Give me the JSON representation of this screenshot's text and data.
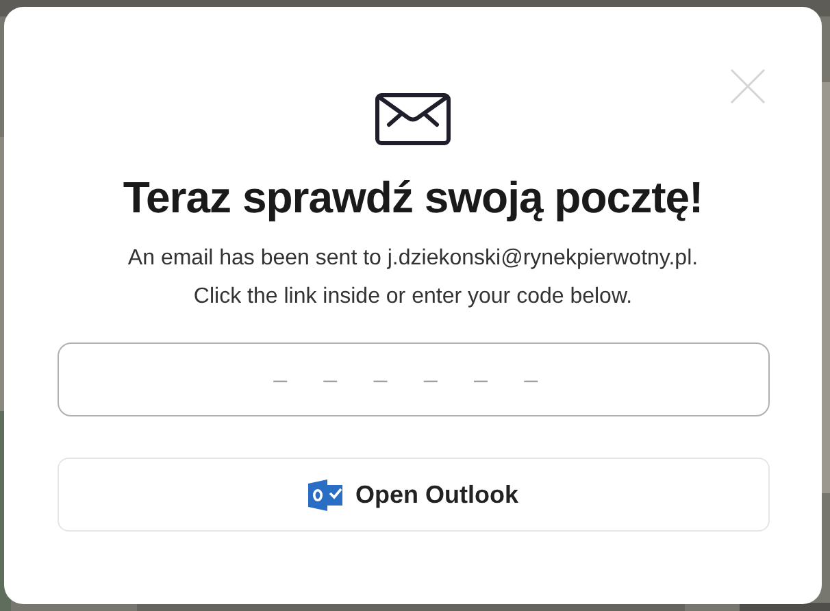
{
  "dialog": {
    "title": "Teraz sprawdź swoją pocztę!",
    "message_lines": [
      "An email has been sent to j.dziekonski@rynekpierwotny.pl.",
      "Click the link inside or enter your code below."
    ],
    "code_field": {
      "placeholder": "– – – – – –"
    },
    "button": {
      "label": "Open Outlook"
    }
  }
}
